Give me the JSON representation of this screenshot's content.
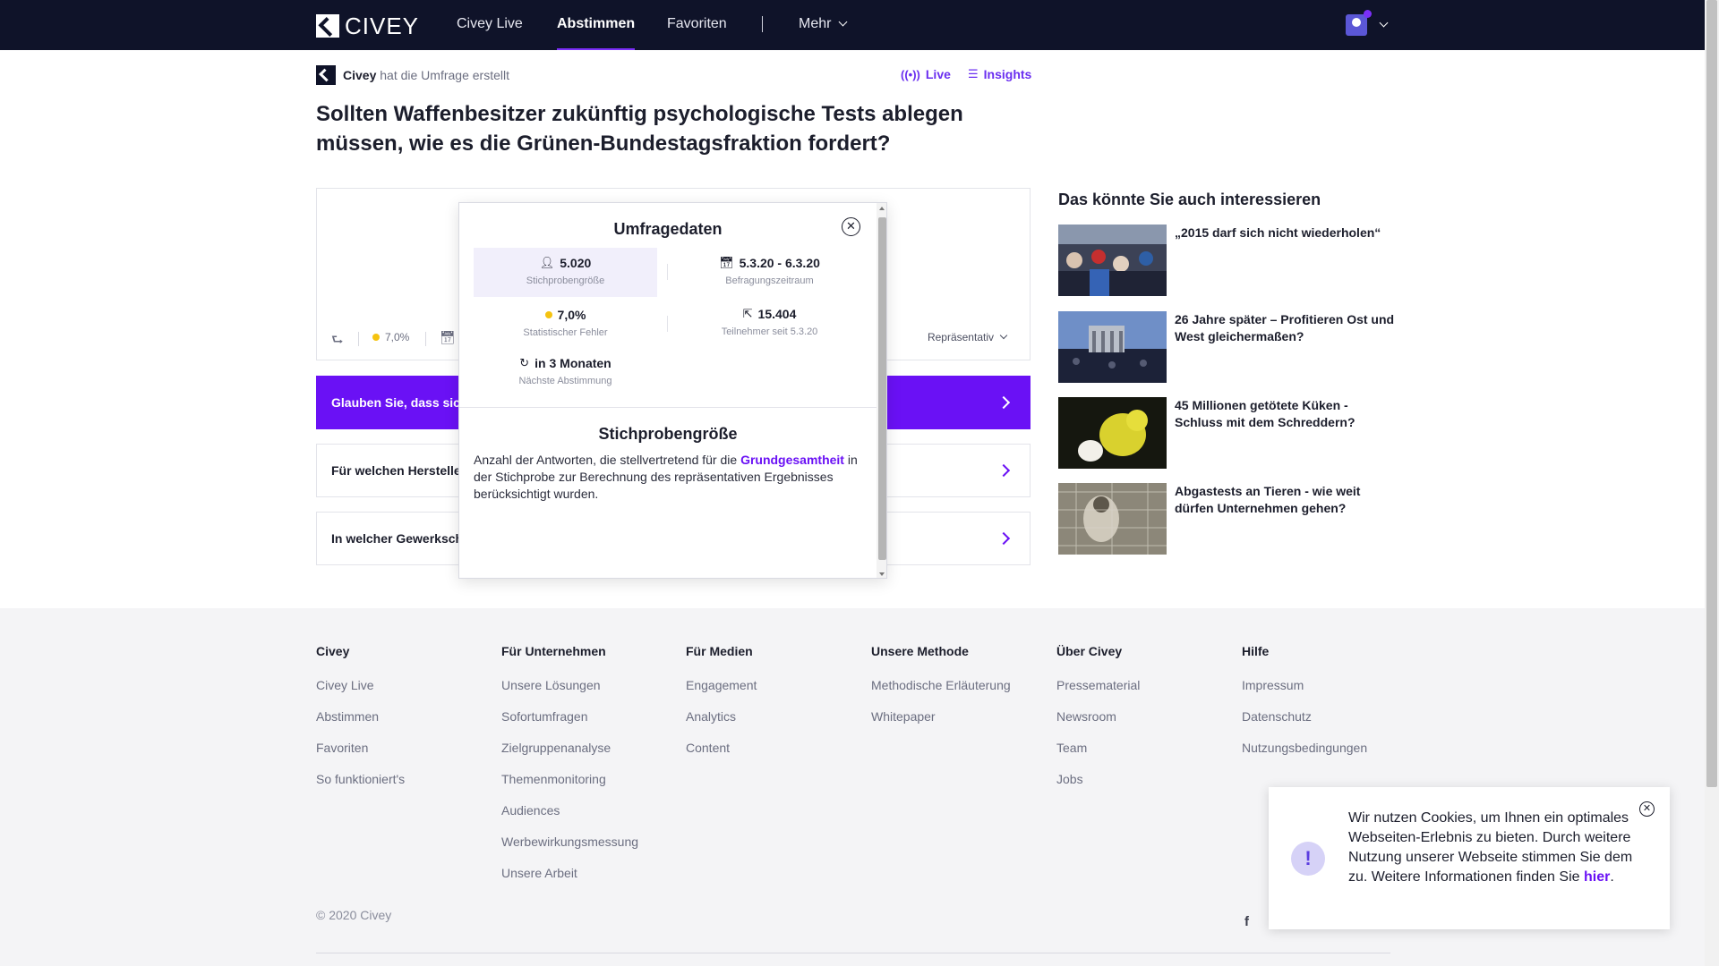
{
  "nav": {
    "logo_text": "CIVEY",
    "links": [
      "Civey Live",
      "Abstimmen",
      "Favoriten"
    ],
    "more": "Mehr"
  },
  "creator": {
    "name": "Civey",
    "suffix": "hat die Umfrage erstellt"
  },
  "top_links": {
    "live": "Live",
    "insights": "Insights"
  },
  "question_title": "Sollten Waffenbesitzer zukünftig psychologische Tests ablegen müssen, wie es die Grünen-Bundestagsfraktion fordert?",
  "poll_meta": {
    "error": "7,0%",
    "representative": "Repräsentativ"
  },
  "questions": [
    "Glauben Sie, dass sich",
    "Für welchen Hersteller",
    "In welcher Gewerkscha"
  ],
  "modal": {
    "title": "Umfragedaten",
    "stats": {
      "sample": {
        "value": "5.020",
        "label": "Stichprobengröße"
      },
      "period": {
        "value": "5.3.20 - 6.3.20",
        "label": "Befragungszeitraum"
      },
      "error": {
        "value": "7,0%",
        "label": "Statistischer Fehler"
      },
      "participants": {
        "value": "15.404",
        "label": "Teilnehmer seit 5.3.20"
      },
      "next": {
        "value": "in 3 Monaten",
        "label": "Nächste Abstimmung"
      }
    },
    "section_title": "Stichprobengröße",
    "desc_before": "Anzahl der Antworten, die stellvertretend für die ",
    "desc_link": "Grundgesamtheit",
    "desc_after": " in der Stichprobe zur Berechnung des repräsentativen Ergebnisses berücksichtigt wurden."
  },
  "sidebar": {
    "title": "Das könnte Sie auch interessieren",
    "items": [
      {
        "text": "„2015 darf sich nicht wiederholen“"
      },
      {
        "text": "26 Jahre später – Profitieren Ost und West gleichermaßen?"
      },
      {
        "text": "45 Millionen getötete Küken - Schluss mit dem Schreddern?"
      },
      {
        "text": "Abgastests an Tieren - wie weit dürfen Unternehmen gehen?"
      }
    ]
  },
  "footer": {
    "columns": [
      {
        "head": "Civey",
        "items": [
          "Civey Live",
          "Abstimmen",
          "Favoriten",
          "So funktioniert's"
        ]
      },
      {
        "head": "Für Unternehmen",
        "items": [
          "Unsere Lösungen",
          "Sofortumfragen",
          "Zielgruppenanalyse",
          "Themenmonitoring",
          "Audiences",
          "Werbewirkungsmessung",
          "Unsere Arbeit"
        ]
      },
      {
        "head": "Für Medien",
        "items": [
          "Engagement",
          "Analytics",
          "Content"
        ]
      },
      {
        "head": "Unsere Methode",
        "items": [
          "Methodische Erläuterung",
          "Whitepaper"
        ]
      },
      {
        "head": "Über Civey",
        "items": [
          "Pressematerial",
          "Newsroom",
          "Team",
          "Jobs"
        ]
      },
      {
        "head": "Hilfe",
        "items": [
          "Impressum",
          "Datenschutz",
          "Nutzungsbedingungen"
        ]
      }
    ],
    "copyright": "© 2020 Civey",
    "social": "f"
  },
  "cookie": {
    "text": "Wir nutzen Cookies, um Ihnen ein optimales Webseiten-Erlebnis zu bieten. Durch weitere Nutzung unserer Webseite stimmen Sie dem zu. Weitere Informationen finden Sie ",
    "link": "hier",
    "end": "."
  },
  "colors": {
    "brand_purple": "#6a11f5",
    "nav_bg": "#0f1329",
    "footer_bg": "#f4f4f6"
  }
}
